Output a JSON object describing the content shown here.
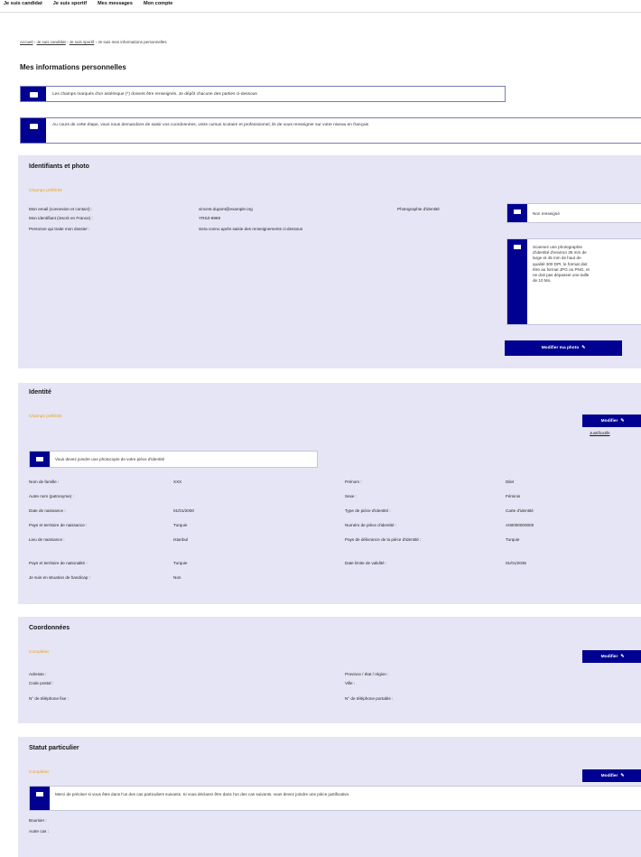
{
  "topnav": [
    "Je suis candidat",
    "Je suis sportif",
    "Mes messages",
    "Mon compte"
  ],
  "breadcrumb": [
    "Accueil",
    "Je suis candidat",
    "Je suis sportif",
    "Je suis mes informations personnelles"
  ],
  "page_title": "Mes informations personnelles",
  "alerts": {
    "required": "Les champs marqués d'un astérisque (*) doivent être renseignés. Je dépôt chacune des parties ci-dessous",
    "french": "Au cours de cette étape, vous nous demandons de saisir vos coordonnées, votre cursus scolaire et professionnel, ils de vous renseigner sur votre niveau en français"
  },
  "identifiants": {
    "title": "Identifiants et photo",
    "hint": "Champs préférés",
    "rows": [
      {
        "label": "Mon email (connexion et contact) :",
        "value": "vincent.dupont@example.org"
      },
      {
        "label": "Mon identifiant (inscrit en France) :",
        "value": "YRSZ-9969"
      },
      {
        "label": "Personne qui traite mon dossier :",
        "value": "Sera connu après saisie des renseignements ci-dessous"
      }
    ],
    "photo_label": "Photographie d'identité",
    "photo_status": "Non renseigné",
    "photo_help": "Scannez une photographie d'identité d'environ 35 mm de large et 45 mm de haut de qualité 300 DPI, le format doit être au format JPG ou PNG, et ne doit pas dépasser une taille de 10 Mo.",
    "button": "Modifier ma photo"
  },
  "identite": {
    "title": "Identité",
    "hint": "Champs préférés",
    "button": "Modifier",
    "link": "Justificatifs",
    "notice": "Vous devez joindre une photocopie de votre pièce d'identité",
    "left": [
      {
        "label": "Nom de famille :",
        "value": "XXX"
      },
      {
        "label": "Autre nom (patronyme) :",
        "value": ""
      },
      {
        "label": "Date de naissance :",
        "value": "01/01/2000"
      },
      {
        "label": "Pays et territoire de naissance :",
        "value": "Turquie"
      },
      {
        "label": "Lieu de naissance :",
        "value": "Istanbul"
      },
      {
        "label": "Pays et territoire de nationalité :",
        "value": "Turquie"
      },
      {
        "label": "Je suis en situation de handicap :",
        "value": "Non"
      }
    ],
    "right": [
      {
        "label": "Prénom :",
        "value": "Dilet"
      },
      {
        "label": "Sexe :",
        "value": "Féminin"
      },
      {
        "label": "Type de pièce d'identité :",
        "value": "Carte d'identité"
      },
      {
        "label": "Numéro de pièce d'identité :",
        "value": "A00000000000"
      },
      {
        "label": "Pays de délivrance de la pièce d'identité :",
        "value": "Turquie"
      },
      {
        "label": "Date limite de validité :",
        "value": "01/01/2035"
      }
    ]
  },
  "coordonnees": {
    "title": "Coordonnées",
    "hint": "Compléter",
    "button": "Modifier",
    "left": [
      "Adresse :",
      "Code postal :",
      "N° de téléphone fixe :"
    ],
    "right": [
      "Province / état / région :",
      "Ville :",
      "N° de téléphone portable :"
    ]
  },
  "statut": {
    "title": "Statut particulier",
    "hint": "Compléter",
    "button": "Modifier",
    "notice": "Merci de préciser si vous êtes dans l'un des cas particuliers suivants. Si vous déclarez être dans l'un des cas suivants, vous devez joindre une pièce justificative.",
    "rows": [
      "Boursier :",
      "Autre cas :"
    ]
  },
  "colors": {
    "primary": "#000091",
    "section_bg": "#e5e5f5",
    "hint": "#e8a020"
  }
}
